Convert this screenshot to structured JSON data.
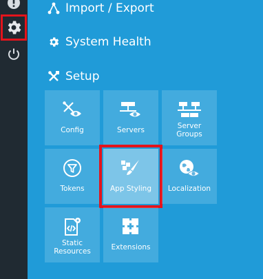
{
  "sidebar": {
    "items": [
      {
        "icon": "alert-icon"
      },
      {
        "icon": "gear-icon",
        "active": true
      },
      {
        "icon": "power-icon"
      }
    ]
  },
  "sections": {
    "import_export": {
      "label": "Import / Export",
      "icon": "share-icon"
    },
    "system_health": {
      "label": "System Health",
      "icon": "gear-icon"
    },
    "setup": {
      "label": "Setup",
      "icon": "tools-icon"
    }
  },
  "tiles": {
    "config": {
      "label": "Config",
      "icon": "tools-eye-icon"
    },
    "servers": {
      "label": "Servers",
      "icon": "server-eye-icon"
    },
    "server_groups": {
      "label_line1": "Server",
      "label_line2": "Groups",
      "icon": "server-network-icon"
    },
    "tokens": {
      "label": "Tokens",
      "icon": "filter-icon"
    },
    "app_styling": {
      "label": "App Styling",
      "icon": "paint-brush-icon",
      "selected": true
    },
    "localization": {
      "label": "Localization",
      "icon": "globe-eye-icon"
    },
    "static_resources": {
      "label_line1": "Static",
      "label_line2": "Resources",
      "icon": "code-file-icon"
    },
    "extensions": {
      "label": "Extensions",
      "icon": "puzzle-icon"
    }
  },
  "colors": {
    "background": "#209bd8",
    "sidebar": "#202a32",
    "highlight": "#e3141c",
    "text": "#ffffff"
  }
}
